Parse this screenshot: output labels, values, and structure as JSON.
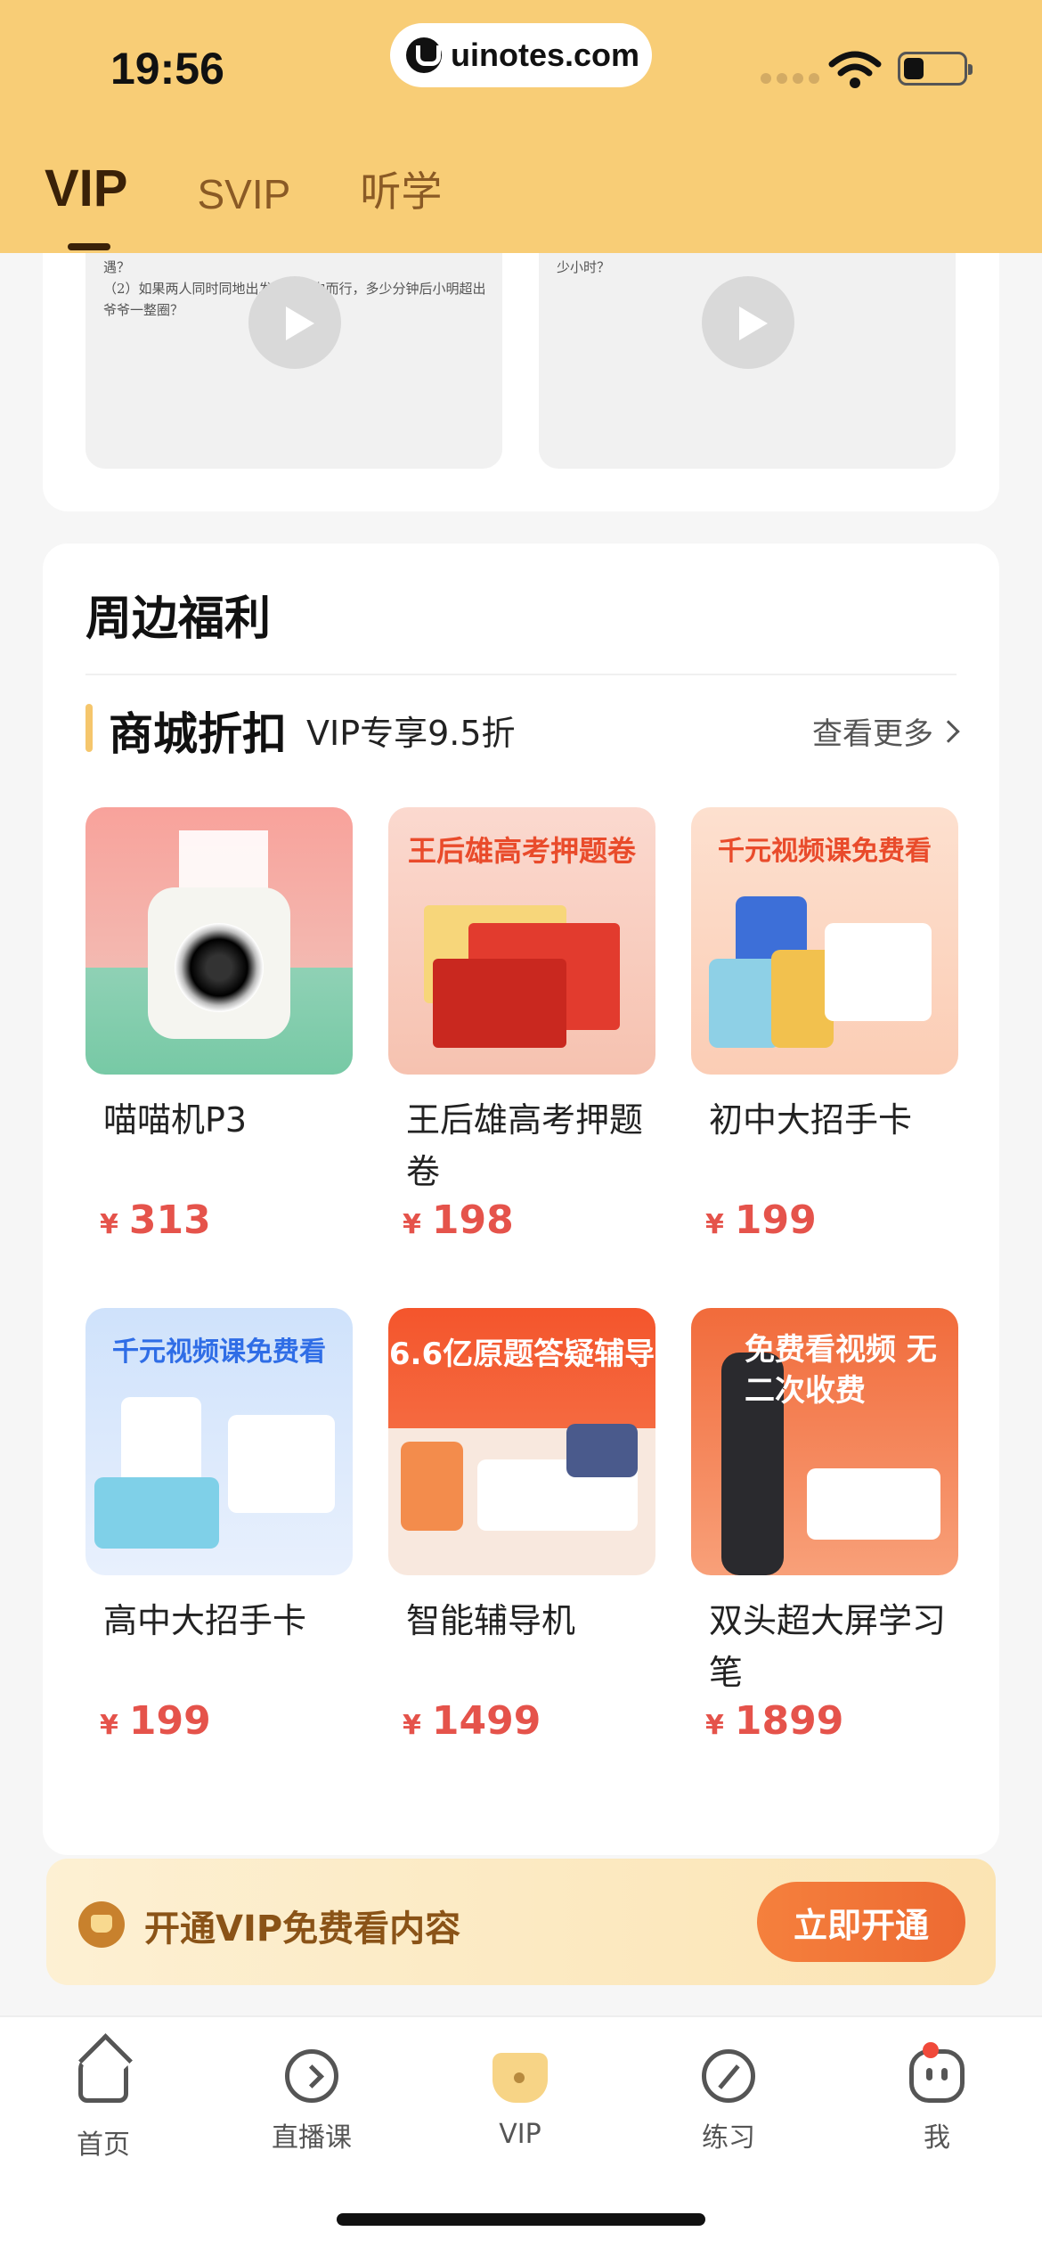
{
  "status_bar": {
    "time": "19:56",
    "url": "uinotes.com"
  },
  "tabs": [
    {
      "label": "VIP",
      "active": true
    },
    {
      "label": "SVIP",
      "active": false
    },
    {
      "label": "听学",
      "active": false
    }
  ],
  "video_cards": [
    {
      "snippet": "遇？\n（2）如果两人同时同地出发，同方向而行，多少分钟后小明超出爷爷一整圈？"
    },
    {
      "snippet": "少小时？"
    }
  ],
  "benefits": {
    "title": "周边福利",
    "mall_title": "商城折扣",
    "mall_subtitle": "VIP专享9.5折",
    "more_label": "查看更多",
    "currency": "¥",
    "products": [
      {
        "name": "喵喵机P3",
        "price": "313",
        "image_banner": ""
      },
      {
        "name": "王后雄高考押题卷",
        "price": "198",
        "image_banner": "王后雄高考押题卷"
      },
      {
        "name": "初中大招手卡",
        "price": "199",
        "image_banner": "千元视频课免费看"
      },
      {
        "name": "高中大招手卡",
        "price": "199",
        "image_banner": "千元视频课免费看"
      },
      {
        "name": "智能辅导机",
        "price": "1499",
        "image_banner": "6.6亿原题答疑辅导"
      },
      {
        "name": "双头超大屏学习笔",
        "price": "1899",
        "image_banner": "免费看视频 无二次收费"
      }
    ]
  },
  "vip_banner": {
    "text": "开通VIP免费看内容",
    "button": "立即开通"
  },
  "bottom_nav": [
    {
      "label": "首页",
      "icon": "home-icon"
    },
    {
      "label": "直播课",
      "icon": "live-icon"
    },
    {
      "label": "VIP",
      "icon": "vip-crown-icon",
      "active": true
    },
    {
      "label": "练习",
      "icon": "practice-icon"
    },
    {
      "label": "我",
      "icon": "me-icon",
      "badge": true
    }
  ],
  "colors": {
    "header_bg": "#f8cd76",
    "price": "#e5534b",
    "accent_button": "#ed6a32"
  }
}
